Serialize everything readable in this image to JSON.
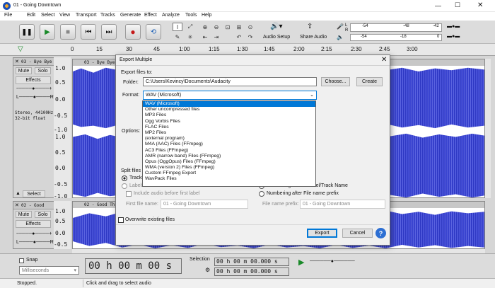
{
  "window": {
    "title": "01 - Going Downtown",
    "controls": [
      "minimize-icon",
      "maximize-icon",
      "close-icon"
    ]
  },
  "menu": [
    "File",
    "Edit",
    "Select",
    "View",
    "Transport",
    "Tracks",
    "Generate",
    "Effect",
    "Analyze",
    "Tools",
    "Help"
  ],
  "toolbar": {
    "audio_setup": "Audio Setup",
    "share_audio": "Share Audio",
    "meter_l": "L",
    "meter_r": "R",
    "meter_ticks": [
      "-54",
      "-48",
      "-42",
      "-18",
      "-12",
      "-6",
      "0"
    ]
  },
  "ruler": {
    "ticks": [
      "0",
      "15",
      "30",
      "45",
      "1:00",
      "1:15",
      "1:30",
      "1:45",
      "2:00",
      "2:15",
      "2:30",
      "2:45",
      "3:00"
    ]
  },
  "tracks": [
    {
      "name": "03 - Bye Bye Love",
      "header": "03 - Bye Bye Lov",
      "mute": "Mute",
      "solo": "Solo",
      "effects": "Effects",
      "info1": "Stereo, 44100Hz",
      "info2": "32-bit float",
      "select": "Select",
      "scale": [
        "1.0",
        "0.5",
        "0.0",
        "-0.5",
        "-1.0",
        "1.0",
        "0.5",
        "0.0",
        "-0.5",
        "-1.0"
      ]
    },
    {
      "name": "02 - Good Thing",
      "header": "02 - Good",
      "mute": "Mute",
      "solo": "Solo",
      "effects": "Effects",
      "scale": [
        "1.0",
        "0.5",
        "0.0",
        "-0.5"
      ]
    }
  ],
  "dialog": {
    "title": "Export Multiple",
    "export_to": "Export files to:",
    "folder_label": "Folder:",
    "folder_value": "C:\\Users\\Kevincy\\Documents\\Audacity",
    "choose": "Choose...",
    "create": "Create",
    "format_label": "Format:",
    "format_value": "WAV (Microsoft)",
    "options_label": "Options:",
    "split_label": "Split files b",
    "tracks_label": "Tracks",
    "labels_label": "Labels",
    "include_audio": "Include audio before first label",
    "first_file_name_label": "First file name:",
    "first_file_name_value": "01 - Going Downtown",
    "numbering_before": "Numbering before Label/Track Name",
    "numbering_after": "Numbering after File name prefix",
    "file_name_prefix_label": "File name prefix:",
    "file_name_prefix_value": "01 - Going Downtown",
    "overwrite": "Overwrite existing files",
    "export": "Export",
    "cancel": "Cancel",
    "help": "?",
    "format_options": [
      "WAV (Microsoft)",
      "Other uncompressed files",
      "MP3 Files",
      "Ogg Vorbis Files",
      "FLAC Files",
      "MP2 Files",
      "(external program)",
      "M4A (AAC) Files (FFmpeg)",
      "AC3 Files (FFmpeg)",
      "AMR (narrow band) Files (FFmpeg)",
      "Opus (OggOpus) Files (FFmpeg)",
      "WMA (version 2) Files (FFmpeg)",
      "Custom FFmpeg Export",
      "WavPack Files"
    ]
  },
  "selection": {
    "snap": "Snap",
    "units": "Milliseconds",
    "time": "00 h 00 m 00 s",
    "selection_label": "Selection",
    "start": "00 h 00 m 00.000 s",
    "end": "00 h 00 m 00.000 s"
  },
  "status": {
    "left": "Stopped.",
    "right": "Click and drag to select audio"
  },
  "colors": {
    "wave": "#3c46d2",
    "wave_light": "#7d86e8",
    "accent": "#0078d7",
    "record": "#c41919",
    "play": "#1a8a2a"
  }
}
